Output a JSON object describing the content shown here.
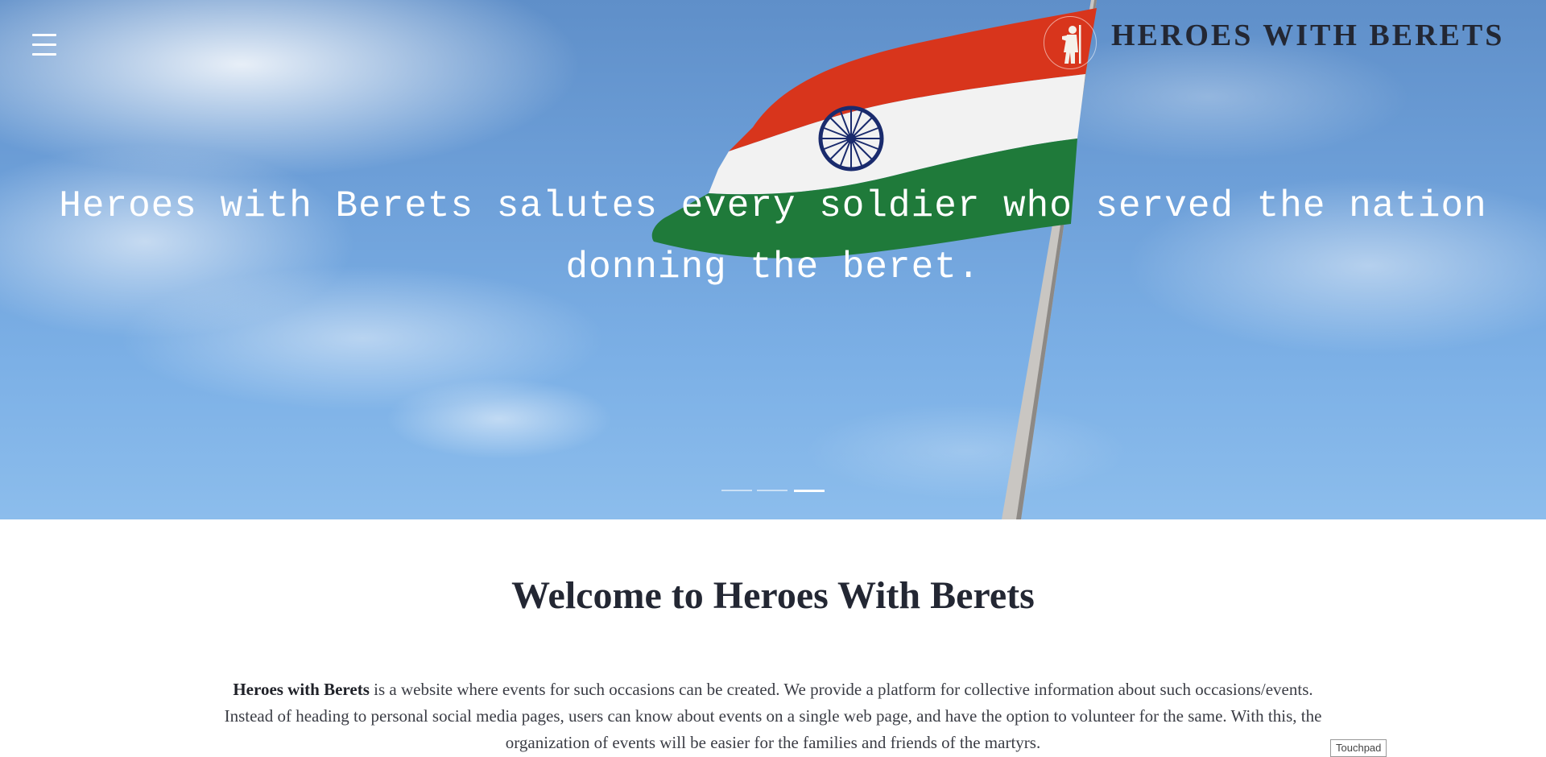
{
  "header": {
    "menu_icon": "hamburger-menu-icon",
    "logo_icon": "soldier-salute-logo-icon",
    "brand_title": "HEROES WITH BERETS"
  },
  "hero": {
    "caption": "Heroes with Berets salutes every soldier who served the nation donning the beret.",
    "slides_total": 3,
    "active_slide": 3,
    "flag_colors": [
      "#d8351c",
      "#f2f2f2",
      "#1f7a3a"
    ],
    "chakra_color": "#1a2b6d"
  },
  "main": {
    "welcome_heading": "Welcome to Heroes With Berets",
    "intro_bold": "Heroes with Berets",
    "intro_text": " is a website where events for such occasions can be created. We provide a platform for collective information about such occasions/events. Instead of heading to personal social media pages, users can know about events on a single web page, and have the option to volunteer for the same. With this, the organization of events will be easier for the families and friends of the martyrs."
  },
  "overlay": {
    "touchpad_label": "Touchpad"
  }
}
